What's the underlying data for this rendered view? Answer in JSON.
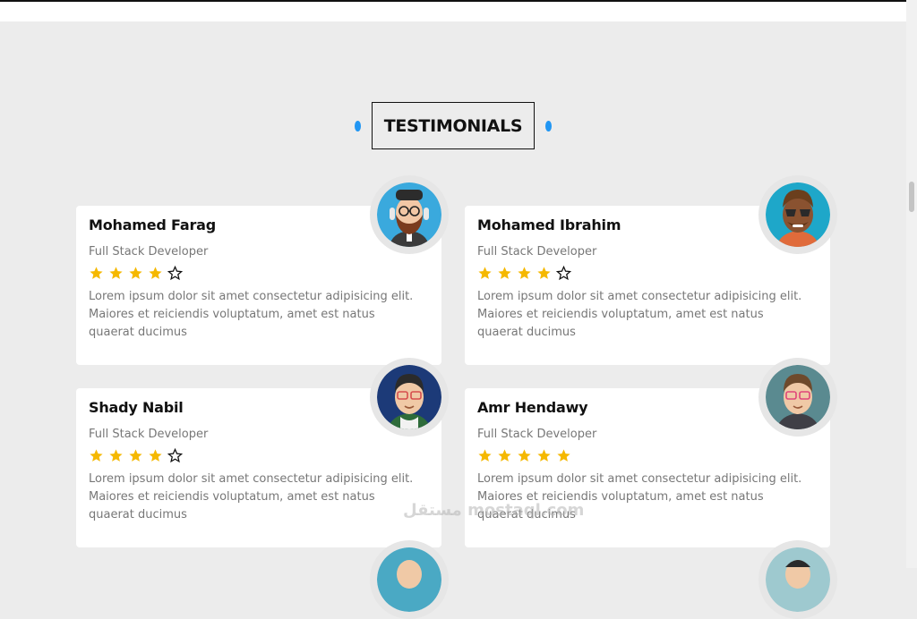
{
  "section": {
    "title": "TESTIMONIALS"
  },
  "colors": {
    "accent": "#2196f3",
    "star": "#f5b800"
  },
  "testimonials": [
    {
      "name": "Mohamed Farag",
      "role": "Full Stack Developer",
      "rating": 4,
      "text": "Lorem ipsum dolor sit amet consectetur adipisicing elit. Maiores et reiciendis voluptatum, amet est natus quaerat ducimus",
      "avatar_icon": "bearded-man-avatar"
    },
    {
      "name": "Mohamed Ibrahim",
      "role": "Full Stack Developer",
      "rating": 4,
      "text": "Lorem ipsum dolor sit amet consectetur adipisicing elit. Maiores et reiciendis voluptatum, amet est natus quaerat ducimus",
      "avatar_icon": "sunglasses-man-avatar"
    },
    {
      "name": "Shady Nabil",
      "role": "Full Stack Developer",
      "rating": 4,
      "text": "Lorem ipsum dolor sit amet consectetur adipisicing elit. Maiores et reiciendis voluptatum, amet est natus quaerat ducimus",
      "avatar_icon": "glasses-man-avatar"
    },
    {
      "name": "Amr Hendawy",
      "role": "Full Stack Developer",
      "rating": 5,
      "text": "Lorem ipsum dolor sit amet consectetur adipisicing elit. Maiores et reiciendis voluptatum, amet est natus quaerat ducimus",
      "avatar_icon": "glasses-man-avatar"
    }
  ],
  "watermark": {
    "text": "مستقل mostaql.com"
  }
}
